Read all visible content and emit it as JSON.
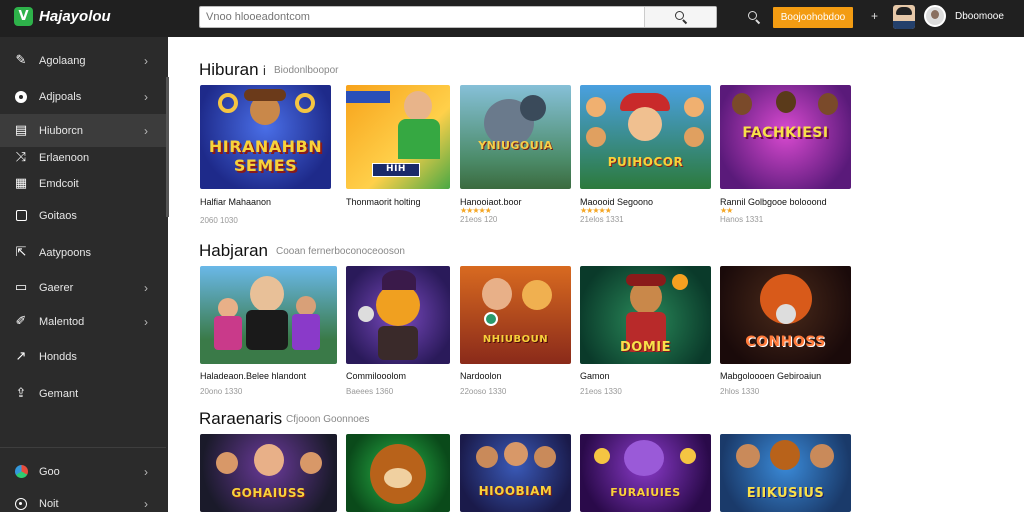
{
  "header": {
    "logo_letter": "V",
    "logo_text": "Hajayolou",
    "search_placeholder": "Vnoo hlooeadontcom",
    "cta_label": "Boojoohobdoo",
    "plus_label": "+",
    "user_name": "Dboomooe"
  },
  "sidebar": {
    "items": [
      {
        "label": "Agolaang",
        "icon": "pencil-icon",
        "chevron": true
      },
      {
        "label": "Adjpoals",
        "icon": "record-icon",
        "chevron": true
      },
      {
        "label": "Hiuborcn",
        "icon": "grid-icon",
        "chevron": true,
        "active": true
      },
      {
        "label": "Erlaenoon",
        "icon": "shuffle-icon",
        "chevron": false
      },
      {
        "label": "Emdcoit",
        "icon": "tiles-icon",
        "chevron": false
      },
      {
        "label": "Goitaos",
        "icon": "square-icon",
        "chevron": false
      },
      {
        "label": "Aatypoons",
        "icon": "export-icon",
        "chevron": false
      },
      {
        "label": "Gaerer",
        "icon": "card-icon",
        "chevron": true
      },
      {
        "label": "Malentod",
        "icon": "wand-icon",
        "chevron": true
      },
      {
        "label": "Hondds",
        "icon": "trend-icon",
        "chevron": false
      },
      {
        "label": "Gemant",
        "icon": "upload-icon",
        "chevron": false
      },
      {
        "label": "Goo",
        "icon": "chrome-icon",
        "chevron": true
      },
      {
        "label": "Noit",
        "icon": "info-icon",
        "chevron": true
      }
    ]
  },
  "sections": [
    {
      "title": "Hiburan",
      "marker": "i",
      "subtitle": "Biodonlboopor",
      "cards": [
        {
          "name": "Halfiar Mahaanon",
          "meta": "2060 1030",
          "art": "HIRANAHBN SEMES",
          "stars": ""
        },
        {
          "name": "Thonmaorit holting",
          "meta": "",
          "art": "HIH",
          "stars": ""
        },
        {
          "name": "Hanooiaot.boor",
          "meta": "21eos 120",
          "art": "YNIUGOUIA",
          "stars": "★★★★★"
        },
        {
          "name": "Maoooid Segoono",
          "meta": "21elos 1331",
          "art": "PUIHOCOR",
          "stars": "★★★★★"
        },
        {
          "name": "Rannil Golbgooe bolooond",
          "meta": "Hanos 1331",
          "art": "FACHKIESI",
          "stars": "★★"
        }
      ]
    },
    {
      "title": "Habjaran",
      "marker": "",
      "subtitle": "Cooan fernerboconoceooson",
      "cards": [
        {
          "name": "Haladeaon.Belee hlandont",
          "meta": "20ono 1330",
          "art": "",
          "stars": ""
        },
        {
          "name": "Commilooolom",
          "meta": "Baeees 1360",
          "art": "",
          "stars": ""
        },
        {
          "name": "Nardoolon",
          "meta": "22ooso 1330",
          "art": "NHIUBOUN",
          "stars": ""
        },
        {
          "name": "Gamon",
          "meta": "21eos 1330",
          "art": "DOMIE",
          "stars": ""
        },
        {
          "name": "Mabgoloooen Gebiroaiun",
          "meta": "2hlos 1330",
          "art": "CONHOSS",
          "stars": ""
        }
      ]
    },
    {
      "title": "Raraenaris",
      "marker": "",
      "subtitle": "Cfjooon Goonnoes",
      "cards": [
        {
          "name": "",
          "meta": "",
          "art": "GOHAIUSS",
          "stars": ""
        },
        {
          "name": "",
          "meta": "",
          "art": "",
          "stars": ""
        },
        {
          "name": "",
          "meta": "",
          "art": "HIOOBIAM",
          "stars": ""
        },
        {
          "name": "",
          "meta": "",
          "art": "FURAIUIES",
          "stars": ""
        },
        {
          "name": "",
          "meta": "",
          "art": "EIIKUSIUS",
          "stars": ""
        }
      ]
    }
  ],
  "colors": {
    "topbar": "#202020",
    "sidebar": "#2b2b2b",
    "accent": "#f39c12",
    "logo": "#2eb24a"
  }
}
